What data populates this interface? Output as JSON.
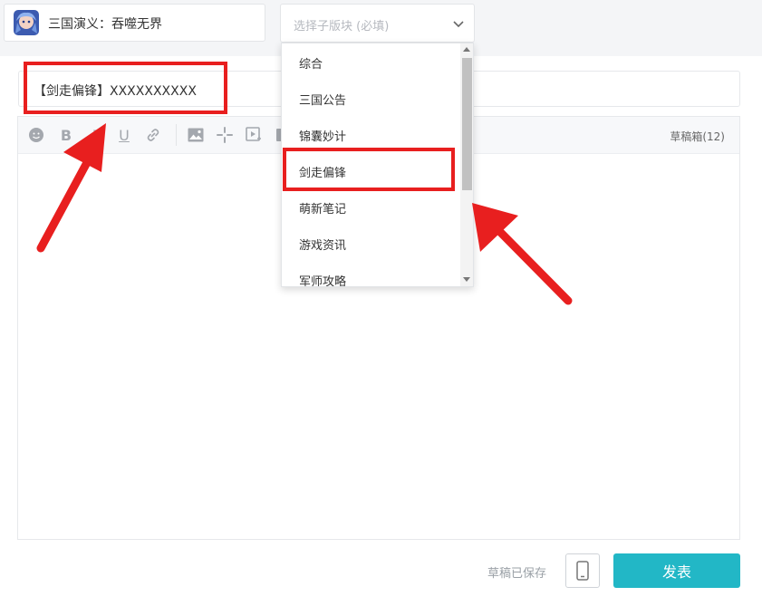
{
  "game": {
    "name": "三国演义：吞噬无界"
  },
  "subforum": {
    "placeholder": "选择子版块 (必填)"
  },
  "post": {
    "title": "【剑走偏锋】XXXXXXXXXX"
  },
  "toolbar": {
    "icons": [
      "emoji-icon",
      "bold-icon",
      "italic-icon",
      "underline-icon",
      "link-icon",
      "image-icon",
      "sparkle-icon",
      "video-icon",
      "more-icon"
    ],
    "draft_box": "草稿箱(12)"
  },
  "dropdown": {
    "options": [
      "综合",
      "三国公告",
      "锦囊妙计",
      "剑走偏锋",
      "萌新笔记",
      "游戏资讯",
      "军师攻略"
    ],
    "highlighted": "剑走偏锋"
  },
  "footer": {
    "saved_status": "草稿已保存",
    "publish": "发表"
  },
  "colors": {
    "accent": "#22b7c6",
    "annotation": "#e81f1f"
  }
}
